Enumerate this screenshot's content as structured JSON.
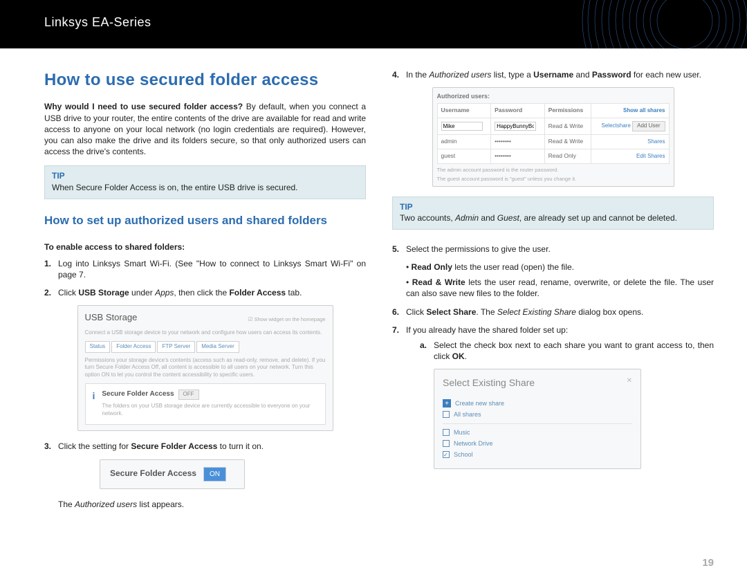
{
  "header": {
    "series": "Linksys EA-Series"
  },
  "title": "How to use secured folder access",
  "intro_q": "Why would I need to use secured folder access?",
  "intro_body": " By default, when you connect a USB drive to your router, the entire contents of the drive are available for read and write access to anyone on your local network (no login credentials are required). However, you can also make the drive and its folders secure, so that only authorized users can access the drive's contents.",
  "tip1_label": "TIP",
  "tip1_body": "When Secure Folder Access is on, the entire USB drive is secured.",
  "subtitle": "How to set up authorized users and shared folders",
  "lead": "To enable access to shared folders:",
  "step1": "Log into Linksys Smart Wi-Fi. (See \"How to connect to Linksys Smart Wi-Fi\" on page 7.",
  "step2_pre": "Click ",
  "step2_b1": "USB Storage",
  "step2_mid": " under ",
  "step2_i1": "Apps",
  "step2_post": ", then click the ",
  "step2_b2": "Folder Access",
  "step2_end": " tab.",
  "usb": {
    "title": "USB Storage",
    "widget": "Show widget on the homepage",
    "desc": "Connect a USB storage device to your network and configure how users can access its contents.",
    "tabs": [
      "Status",
      "Folder Access",
      "FTP Server",
      "Media Server"
    ],
    "sfa_label": "Secure Folder Access",
    "off": "OFF",
    "note1": "Permissions your storage device's contents (access such as read-only, remove, and delete). If you turn Secure Folder Access Off, all content is accessible to all users on your network. Turn this option ON to let you control the content accessibility to specific users.",
    "note2": "The folders on your USB storage device are currently accessible to everyone on your network."
  },
  "step3_pre": "Click the setting for ",
  "step3_b": "Secure Folder Access",
  "step3_post": " to turn it on.",
  "toggle": {
    "label": "Secure Folder Access",
    "state": "ON"
  },
  "step3_tail_pre": "The ",
  "step3_tail_i": "Authorized users",
  "step3_tail_post": " list appears.",
  "step4_pre": "In the ",
  "step4_i": "Authorized users",
  "step4_mid": " list, type a ",
  "step4_b1": "Username",
  "step4_and": " and ",
  "step4_b2": "Password",
  "step4_post": " for each new user.",
  "auth_table": {
    "caption": "Authorized users:",
    "cols": [
      "Username",
      "Password",
      "Permissions",
      ""
    ],
    "show_all": "Show all shares",
    "rows": [
      {
        "u": "Mike",
        "p": "HappyBunnyBows",
        "perm": "Read & Write",
        "a1": "Selectshare",
        "a2": "Add User"
      },
      {
        "u": "admin",
        "p": "••••••••",
        "perm": "Read & Write",
        "a1": "",
        "a2": "Shares"
      },
      {
        "u": "guest",
        "p": "••••••••",
        "perm": "Read Only",
        "a1": "Edit",
        "a2": "Shares"
      }
    ],
    "note_a": "The admin account password is the router password.",
    "note_b": "The guest account password is \"guest\" unless you change it."
  },
  "tip2_label": "TIP",
  "tip2_pre": "Two accounts, ",
  "tip2_i1": "Admin",
  "tip2_and": " and ",
  "tip2_i2": "Guest",
  "tip2_post": ", are already set up and cannot be deleted.",
  "step5": "Select the permissions to give the user.",
  "bullet1_b": "Read Only",
  "bullet1_t": " lets the user read (open) the file.",
  "bullet2_b": "Read & Write",
  "bullet2_t": " lets the user read, rename, overwrite, or delete the file. The user can also save new files to the folder.",
  "step6_pre": "Click ",
  "step6_b": "Select Share",
  "step6_mid": ". The ",
  "step6_i": "Select Existing Share",
  "step6_post": " dialog box opens.",
  "step7": "If you already have the shared folder set up:",
  "step7a_pre": "Select the check box next to each share you want to grant access to, then click ",
  "step7a_b": "OK",
  "step7a_post": ".",
  "share_dialog": {
    "title": "Select Existing Share",
    "create": "Create new share",
    "all": "All shares",
    "items": [
      {
        "label": "Music",
        "checked": false
      },
      {
        "label": "Network Drive",
        "checked": false
      },
      {
        "label": "School",
        "checked": true
      }
    ]
  },
  "page_num": "19"
}
